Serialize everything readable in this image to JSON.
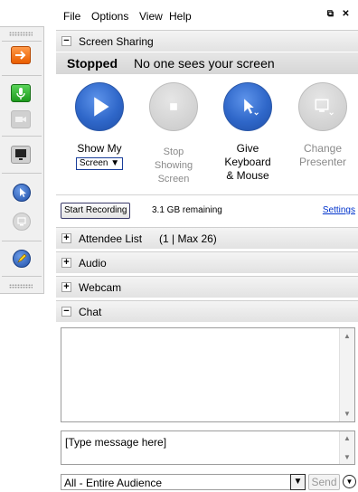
{
  "menu": {
    "file": "File",
    "options": "Options",
    "view": "View",
    "help": "Help"
  },
  "sections": {
    "screen_sharing": "Screen Sharing",
    "attendee_list": "Attendee List",
    "attendee_count": "(1 | Max 26)",
    "audio": "Audio",
    "webcam": "Webcam",
    "chat": "Chat"
  },
  "status": {
    "state": "Stopped",
    "message": "No one sees your screen"
  },
  "controls": {
    "show_my_line1": "Show My",
    "show_my_dropdown": "Screen ▼",
    "stop_line1": "Stop",
    "stop_line2": "Showing",
    "stop_line3": "Screen",
    "give_line1": "Give",
    "give_line2": "Keyboard",
    "give_line3": "& Mouse",
    "change_line1": "Change",
    "change_line2": "Presenter"
  },
  "recording": {
    "button": "Start Recording",
    "remaining": "3.1 GB remaining",
    "settings": "Settings"
  },
  "chat": {
    "placeholder": "[Type message here]",
    "audience": "All - Entire Audience",
    "send": "Send"
  },
  "icons": {
    "toggle_minus": "−",
    "toggle_plus": "+",
    "scroll_up": "▲",
    "scroll_down": "▼",
    "dropdown": "▼"
  },
  "colors": {
    "accent_blue": "#2f67c9",
    "rail_orange": "#e95d00",
    "rail_green": "#1d9a1d",
    "link": "#0033cc"
  }
}
